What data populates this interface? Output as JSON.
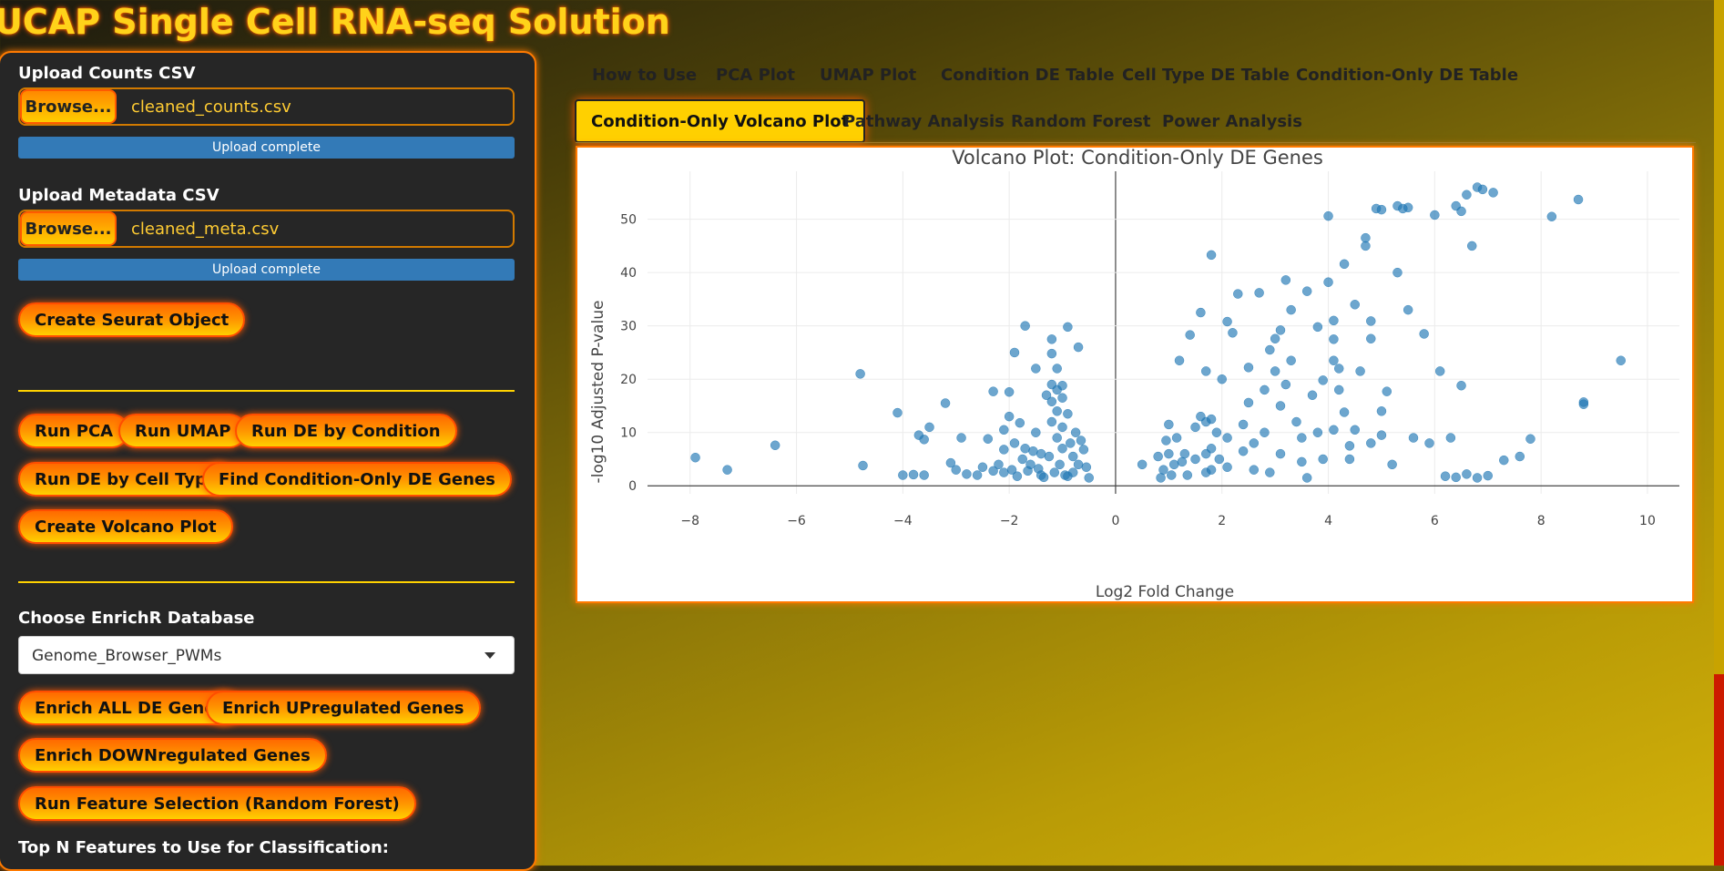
{
  "app": {
    "title": "UCAP Single Cell RNA-seq Solution"
  },
  "sidebar": {
    "counts_label": "Upload Counts CSV",
    "counts_browse": "Browse...",
    "counts_file": "cleaned_counts.csv",
    "counts_status": "Upload complete",
    "meta_label": "Upload Metadata CSV",
    "meta_browse": "Browse...",
    "meta_file": "cleaned_meta.csv",
    "meta_status": "Upload complete",
    "create_seurat": "Create Seurat Object",
    "run_pca": "Run PCA",
    "run_umap": "Run UMAP",
    "run_de_condition": "Run DE by Condition",
    "run_de_celltype": "Run DE by Cell Type",
    "find_condition_only": "Find Condition-Only DE Genes",
    "create_volcano": "Create Volcano Plot",
    "enrichr_label": "Choose EnrichR Database",
    "enrichr_value": "Genome_Browser_PWMs",
    "enrich_all": "Enrich ALL DE Genes",
    "enrich_up": "Enrich UPregulated Genes",
    "enrich_down": "Enrich DOWNregulated Genes",
    "run_rf": "Run Feature Selection (Random Forest)",
    "topn_label": "Top N Features to Use for Classification:"
  },
  "tabs": [
    "How to Use",
    "PCA Plot",
    "UMAP Plot",
    "Condition DE Table",
    "Cell Type DE Table",
    "Condition-Only DE Table",
    "Condition-Only Volcano Plot",
    "Pathway Analysis",
    "Random Forest",
    "Power Analysis"
  ],
  "active_tab": "Condition-Only Volcano Plot",
  "colors": {
    "accent": "#ff7a00",
    "title": "#ffd21a",
    "marker": "#1f77b4",
    "progress": "#337ab7"
  },
  "chart_data": {
    "type": "scatter",
    "title": "Volcano Plot: Condition-Only DE Genes",
    "xlabel": "Log2 Fold Change",
    "ylabel": "-log10 Adjusted P-value",
    "xlim": [
      -8.8,
      10.6
    ],
    "ylim": [
      -1.5,
      59
    ],
    "xticks": [
      -8,
      -6,
      -4,
      -2,
      0,
      2,
      4,
      6,
      8,
      10
    ],
    "yticks": [
      0,
      10,
      20,
      30,
      40,
      50
    ],
    "grid": true,
    "points": [
      [
        -7.9,
        5.3
      ],
      [
        -7.3,
        3
      ],
      [
        -6.4,
        7.6
      ],
      [
        -4.8,
        21
      ],
      [
        -4.75,
        3.8
      ],
      [
        -4.1,
        13.7
      ],
      [
        -4,
        2
      ],
      [
        -3.8,
        2.1
      ],
      [
        -3.7,
        9.5
      ],
      [
        -3.6,
        8.7
      ],
      [
        -3.5,
        11
      ],
      [
        -3.6,
        2
      ],
      [
        -3.2,
        15.5
      ],
      [
        -3.1,
        4.3
      ],
      [
        -3,
        3
      ],
      [
        -2.9,
        9
      ],
      [
        -2.8,
        2.2
      ],
      [
        -2.5,
        3.5
      ],
      [
        -2.4,
        8.8
      ],
      [
        -2.3,
        17.7
      ],
      [
        -2.2,
        4
      ],
      [
        -2.1,
        10.5
      ],
      [
        -2.1,
        2.5
      ],
      [
        -2,
        17.6
      ],
      [
        -2,
        13
      ],
      [
        -1.9,
        25
      ],
      [
        -1.9,
        8
      ],
      [
        -1.8,
        11.8
      ],
      [
        -1.7,
        30
      ],
      [
        -1.7,
        7
      ],
      [
        -1.6,
        4
      ],
      [
        -1.5,
        22
      ],
      [
        -1.5,
        10
      ],
      [
        -1.4,
        6
      ],
      [
        -1.4,
        2
      ],
      [
        -1.3,
        17
      ],
      [
        -1.2,
        27.5
      ],
      [
        -1.2,
        24.8
      ],
      [
        -1.2,
        19
      ],
      [
        -1.2,
        15.8
      ],
      [
        -1.2,
        12
      ],
      [
        -1.1,
        22
      ],
      [
        -1.1,
        18
      ],
      [
        -1.1,
        14
      ],
      [
        -1.1,
        9
      ],
      [
        -1.05,
        4
      ],
      [
        -1,
        18.8
      ],
      [
        -1,
        16.5
      ],
      [
        -1,
        11
      ],
      [
        -1,
        7
      ],
      [
        -0.95,
        2
      ],
      [
        -0.9,
        29.8
      ],
      [
        -0.9,
        13.5
      ],
      [
        -0.85,
        8
      ],
      [
        -0.8,
        5.5
      ],
      [
        -0.8,
        2.5
      ],
      [
        -0.75,
        10
      ],
      [
        -0.7,
        4
      ],
      [
        -0.7,
        26
      ],
      [
        -0.65,
        8.5
      ],
      [
        -0.6,
        6.8
      ],
      [
        -0.55,
        3.5
      ],
      [
        -0.5,
        1.5
      ],
      [
        -2.6,
        2
      ],
      [
        -2.3,
        2.8
      ],
      [
        -2.1,
        6.8
      ],
      [
        -1.95,
        3
      ],
      [
        -1.85,
        1.8
      ],
      [
        -1.75,
        5
      ],
      [
        -1.65,
        2.8
      ],
      [
        -1.55,
        6.5
      ],
      [
        -1.45,
        3.2
      ],
      [
        -1.35,
        1.6
      ],
      [
        -1.25,
        5.5
      ],
      [
        -1.15,
        2.5
      ],
      [
        -0.9,
        1.8
      ],
      [
        0.5,
        4
      ],
      [
        0.8,
        5.5
      ],
      [
        0.85,
        1.5
      ],
      [
        0.9,
        3
      ],
      [
        0.95,
        8.5
      ],
      [
        1,
        11.5
      ],
      [
        1,
        6
      ],
      [
        1.05,
        2
      ],
      [
        1.1,
        4
      ],
      [
        1.15,
        9
      ],
      [
        1.2,
        23.5
      ],
      [
        1.25,
        4.5
      ],
      [
        1.3,
        6
      ],
      [
        1.35,
        2
      ],
      [
        1.4,
        28.3
      ],
      [
        1.5,
        11
      ],
      [
        1.5,
        5
      ],
      [
        1.6,
        32.5
      ],
      [
        1.6,
        13
      ],
      [
        1.7,
        21.5
      ],
      [
        1.7,
        12
      ],
      [
        1.7,
        6
      ],
      [
        1.7,
        2.5
      ],
      [
        1.8,
        43.3
      ],
      [
        1.8,
        12.5
      ],
      [
        1.8,
        7
      ],
      [
        1.8,
        3
      ],
      [
        1.9,
        10
      ],
      [
        1.95,
        5
      ],
      [
        2,
        20
      ],
      [
        2.1,
        30.8
      ],
      [
        2.1,
        9
      ],
      [
        2.1,
        3.5
      ],
      [
        2.2,
        28.7
      ],
      [
        2.3,
        36
      ],
      [
        2.4,
        11.5
      ],
      [
        2.4,
        6.5
      ],
      [
        2.5,
        15.6
      ],
      [
        2.5,
        22.2
      ],
      [
        2.6,
        8
      ],
      [
        2.6,
        3
      ],
      [
        2.7,
        36.2
      ],
      [
        2.8,
        10
      ],
      [
        2.8,
        18
      ],
      [
        2.9,
        25.5
      ],
      [
        2.9,
        2.5
      ],
      [
        3,
        27.6
      ],
      [
        3,
        21.5
      ],
      [
        3.1,
        15
      ],
      [
        3.1,
        29.2
      ],
      [
        3.1,
        6
      ],
      [
        3.2,
        38.6
      ],
      [
        3.2,
        19
      ],
      [
        3.3,
        33
      ],
      [
        3.3,
        23.5
      ],
      [
        3.4,
        12
      ],
      [
        3.5,
        9
      ],
      [
        3.5,
        4.5
      ],
      [
        3.6,
        36.5
      ],
      [
        3.6,
        1.5
      ],
      [
        3.7,
        17
      ],
      [
        3.8,
        29.8
      ],
      [
        3.8,
        10
      ],
      [
        3.9,
        5
      ],
      [
        3.9,
        19.8
      ],
      [
        4,
        38.2
      ],
      [
        4,
        50.6
      ],
      [
        4.1,
        27.5
      ],
      [
        4.1,
        31
      ],
      [
        4.1,
        23.5
      ],
      [
        4.1,
        10.5
      ],
      [
        4.2,
        18
      ],
      [
        4.2,
        22
      ],
      [
        4.3,
        41.6
      ],
      [
        4.3,
        13.8
      ],
      [
        4.4,
        5
      ],
      [
        4.4,
        7.5
      ],
      [
        4.5,
        34
      ],
      [
        4.5,
        10.5
      ],
      [
        4.6,
        21.5
      ],
      [
        4.7,
        46.5
      ],
      [
        4.7,
        45
      ],
      [
        4.8,
        30.9
      ],
      [
        4.8,
        27.6
      ],
      [
        4.8,
        8
      ],
      [
        4.9,
        52
      ],
      [
        5,
        51.8
      ],
      [
        5,
        14
      ],
      [
        5,
        9.5
      ],
      [
        5.1,
        17.7
      ],
      [
        5.2,
        4
      ],
      [
        5.3,
        52.5
      ],
      [
        5.3,
        40
      ],
      [
        5.4,
        52
      ],
      [
        5.5,
        52.2
      ],
      [
        5.5,
        33
      ],
      [
        5.6,
        9
      ],
      [
        5.8,
        28.5
      ],
      [
        5.9,
        8
      ],
      [
        6,
        50.8
      ],
      [
        6.1,
        21.5
      ],
      [
        6.3,
        9
      ],
      [
        6.4,
        52.5
      ],
      [
        6.5,
        51.5
      ],
      [
        6.5,
        18.8
      ],
      [
        6.6,
        54.6
      ],
      [
        6.7,
        45
      ],
      [
        6.8,
        56
      ],
      [
        6.9,
        55.6
      ],
      [
        7.1,
        55
      ],
      [
        7.3,
        4.8
      ],
      [
        7.6,
        5.5
      ],
      [
        7.8,
        8.8
      ],
      [
        8.2,
        50.5
      ],
      [
        8.7,
        53.7
      ],
      [
        8.8,
        15.3
      ],
      [
        8.8,
        15.7
      ],
      [
        9.5,
        23.5
      ],
      [
        6.2,
        1.8
      ],
      [
        6.6,
        2.2
      ],
      [
        6.4,
        1.6
      ],
      [
        6.8,
        1.5
      ],
      [
        7,
        1.9
      ]
    ]
  }
}
